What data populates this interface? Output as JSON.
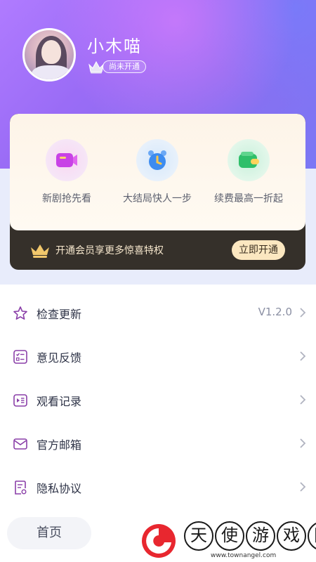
{
  "profile": {
    "username": "小木喵",
    "vip_status": "尚未开通"
  },
  "membership": {
    "features": [
      {
        "label": "新剧抢先看",
        "icon": "video-icon"
      },
      {
        "label": "大结局快人一步",
        "icon": "alarm-clock-icon"
      },
      {
        "label": "续费最高一折起",
        "icon": "wallet-icon"
      }
    ],
    "promo_text": "开通会员享更多惊喜特权",
    "open_button": "立即开通"
  },
  "menu": {
    "items": [
      {
        "label": "检查更新",
        "value": "V1.2.0",
        "icon": "star-icon"
      },
      {
        "label": "意见反馈",
        "value": "",
        "icon": "checklist-icon"
      },
      {
        "label": "观看记录",
        "value": "",
        "icon": "play-history-icon"
      },
      {
        "label": "官方邮箱",
        "value": "",
        "icon": "mail-icon"
      },
      {
        "label": "隐私协议",
        "value": "",
        "icon": "document-icon"
      }
    ]
  },
  "nav": {
    "home_label": "首页"
  },
  "watermark": {
    "chars": [
      "天",
      "使",
      "游",
      "戏",
      "网"
    ],
    "url": "www.townangel.com"
  },
  "colors": {
    "accent": "#8c6df0",
    "gold": "#f1c76b",
    "card_dark": "#35302a"
  }
}
